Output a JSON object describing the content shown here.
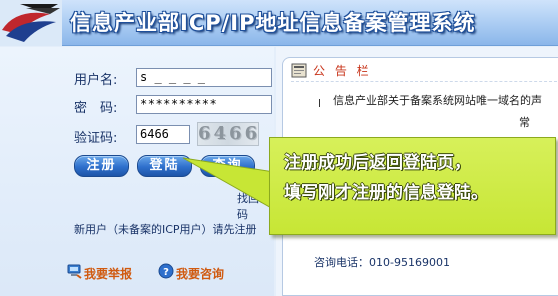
{
  "header": {
    "title": "信息产业部ICP/IP地址信息备案管理系统"
  },
  "login": {
    "username_label": "用户名:",
    "username_value": "s _  _  _  _",
    "password_label": "密　码:",
    "password_value": "**********",
    "captcha_label": "验证码:",
    "captcha_value": "6466",
    "captcha_image_text": "6466",
    "register_label": "注册",
    "login_label": "登陆",
    "query_label": "查询",
    "forgot_label": "找回密码",
    "new_user_text": "新用户（未备案的ICP用户）请先注册"
  },
  "links": {
    "report_label": "我要举报",
    "consult_label": "我要咨询"
  },
  "notice": {
    "title": "公 告 栏",
    "line_1": "信息产业部关于备案系统网站唯一域名的声",
    "line_2": "常",
    "phone": "咨询电话：010-95169001"
  },
  "callout": {
    "line_1": "注册成功后返回登陆页，",
    "line_2": "填写刚才注册的信息登陆。"
  },
  "colors": {
    "header_blue": "#8bb6ea",
    "callout_green": "#c7e635",
    "button_blue": "#2e6fcc",
    "notice_red": "#c8341a"
  },
  "icons": {
    "logo": "emblem-logo",
    "notice": "notice-board-icon",
    "report": "computer-icon",
    "consult": "help-icon"
  }
}
